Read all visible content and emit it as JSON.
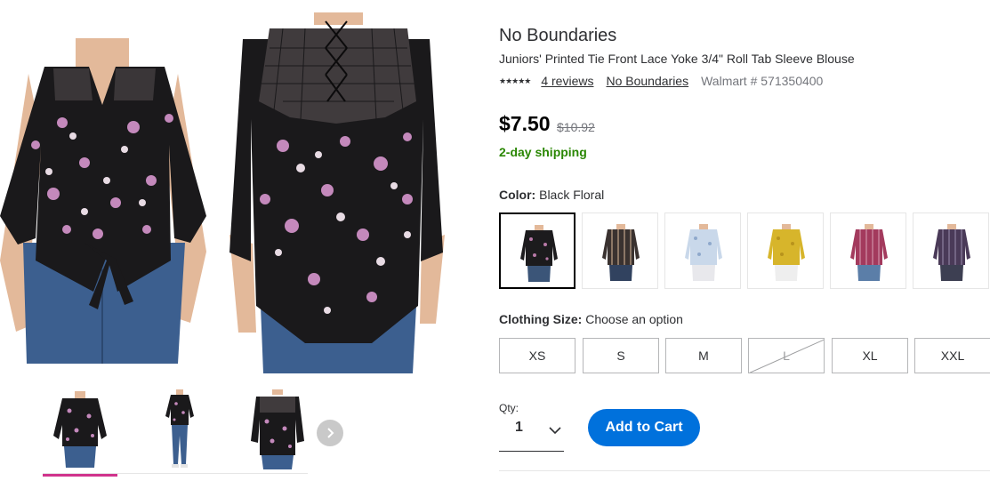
{
  "product": {
    "brand": "No Boundaries",
    "name": "Juniors' Printed Tie Front Lace Yoke 3/4\" Roll Tab Sleeve Blouse",
    "stars": "★★★★★",
    "reviews_link": "4 reviews",
    "brand_link": "No Boundaries",
    "walmart_number": "Walmart # 571350400",
    "price": "$7.50",
    "was_price": "$10.92",
    "shipping": "2-day shipping"
  },
  "color": {
    "label": "Color:",
    "selected": "Black Floral",
    "swatches": [
      {
        "name": "Black Floral",
        "shirt": "#1c1b1d",
        "accent": "#b87aa8",
        "pants": "#3b5578",
        "selected": true
      },
      {
        "name": "Black Stripe",
        "shirt": "#3a3230",
        "accent": "#a88e78",
        "pants": "#31425f",
        "selected": false
      },
      {
        "name": "Light Blue Floral",
        "shirt": "#c9d8ea",
        "accent": "#8fa9cc",
        "pants": "#e8e8ec",
        "selected": false
      },
      {
        "name": "Mustard Floral",
        "shirt": "#d7b52b",
        "accent": "#b8931c",
        "pants": "#eeeeee",
        "selected": false
      },
      {
        "name": "Berry Stripe",
        "shirt": "#a33a5d",
        "accent": "#d8a2b6",
        "pants": "#5b7ea8",
        "selected": false
      },
      {
        "name": "Navy Stripe",
        "shirt": "#4a3a58",
        "accent": "#9a8fae",
        "pants": "#3d3f52",
        "selected": false
      }
    ]
  },
  "size": {
    "label": "Clothing Size:",
    "prompt": "Choose an option",
    "options": [
      {
        "label": "XS",
        "available": true
      },
      {
        "label": "S",
        "available": true
      },
      {
        "label": "M",
        "available": true
      },
      {
        "label": "L",
        "available": false
      },
      {
        "label": "XL",
        "available": true
      },
      {
        "label": "XXL",
        "available": true
      }
    ]
  },
  "qty": {
    "label": "Qty:",
    "value": "1"
  },
  "cart": {
    "button_label": "Add to Cart"
  },
  "gallery": {
    "thumbnails": [
      "front",
      "full-body",
      "back"
    ],
    "selected_thumbnail": 0,
    "next_icon": "chevron-right-icon"
  },
  "colors": {
    "primary_blue": "#0071dc",
    "shipping_green": "#2a8703",
    "thumb_highlight": "#d0338c",
    "muted_text": "#74767c"
  }
}
